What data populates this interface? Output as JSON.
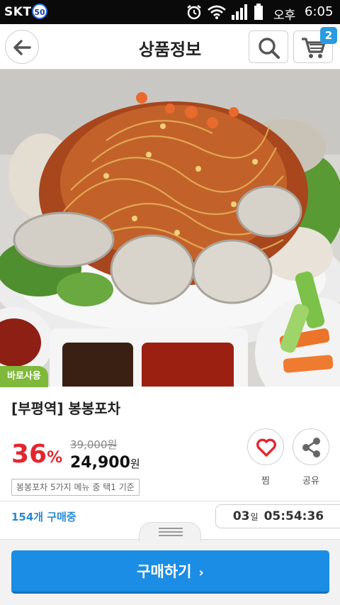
{
  "status_bar": {
    "carrier": "SKT",
    "badge": "50",
    "ampm": "오후",
    "time": "6:05"
  },
  "header": {
    "title": "상품정보",
    "cart_count": "2"
  },
  "product": {
    "badge": "바로사용",
    "name": "[부평역] 봉봉포차",
    "discount": "36",
    "discount_unit": "%",
    "original_price": "39,000원",
    "sale_price": "24,900",
    "sale_price_unit": "원",
    "note": "봉봉포차 5가지 메뉴 중 택1 기준"
  },
  "actions": {
    "wish_label": "찜",
    "share_label": "공유"
  },
  "deal": {
    "buyers": "154개 구매중",
    "timer_days": "03",
    "timer_days_unit": "일",
    "timer_clock": "05:54:36"
  },
  "buy_button": {
    "label": "구매하기",
    "chevron": "›"
  },
  "colors": {
    "accent_blue": "#1b8de4",
    "discount_red": "#e5262e",
    "badge_green": "#7fb83a"
  }
}
